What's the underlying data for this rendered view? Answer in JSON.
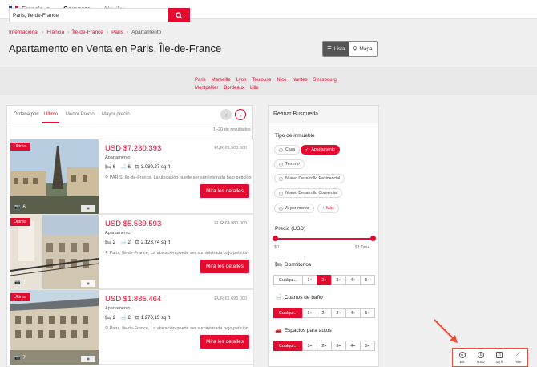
{
  "colors": {
    "brand": "#e30b2f",
    "flag": [
      "#1a3c8f",
      "#ffffff",
      "#e30b2f"
    ]
  },
  "header": {
    "country": "Francia",
    "tabs": [
      {
        "label": "Comprar",
        "active": true
      },
      {
        "label": "Alquilar",
        "active": false
      }
    ]
  },
  "breadcrumb": [
    "Internacional",
    "Francia",
    "Île-de-France",
    "Paris",
    "Apartamento"
  ],
  "page_title": "Apartamento en Venta en Paris, Île-de-France",
  "view_toggle": {
    "list_label": "Lista",
    "map_label": "Mapa",
    "selected": "list"
  },
  "search": {
    "value": "Paris, Île-de-France",
    "button_icon": "search-icon",
    "cities": [
      "Paris",
      "Marseille",
      "Lyon",
      "Toulouse",
      "Nice",
      "Nantes",
      "Strasbourg",
      "Montpellier",
      "Bordeaux",
      "Lille"
    ]
  },
  "sort": {
    "label": "Ordena por:",
    "options": [
      "Último",
      "Menor Precio",
      "Mayor precio"
    ],
    "selected": 0
  },
  "results_count": "1–20 de resultados",
  "listings": [
    {
      "badge": "Último",
      "photo_count": "6",
      "price": "USD $7.230.393",
      "eur_price": "EUR €6.500.000",
      "type": "Apartamento",
      "bedrooms": "6",
      "bathrooms": "6",
      "area": "3.089,27 sq ft",
      "location": "PARIS, Île-de-France, La ubicación puede ser suministrada bajo petición",
      "button": "Mira los detalles"
    },
    {
      "badge": "Último",
      "photo_count": "7",
      "price": "USD $5.539.593",
      "eur_price": "EUR €4.980.000",
      "type": "Apartamento",
      "bedrooms": "2",
      "bathrooms": "2",
      "area": "2.123,74 sq ft",
      "location": "Paris, Île-de-France, La ubicación puede ser suministrada bajo petición",
      "button": "Mira los detalles"
    },
    {
      "badge": "Último",
      "photo_count": "7",
      "price": "USD $1.885.464",
      "eur_price": "EUR €1.695.000",
      "type": "Apartamento",
      "bedrooms": "2",
      "bathrooms": "2",
      "area": "1.270,15 sq ft",
      "location": "Paris, Île-de-France, La ubicación puede ser suministrada bajo petición",
      "button": "Mira los detalles"
    }
  ],
  "filters": {
    "title": "Refinar Busqueda",
    "property_type": {
      "label": "Tipo de inmueble",
      "options": [
        "Casa",
        "Apartamento",
        "Terreno",
        "Nuevo Desarrollo Residencial",
        "Nuevo Desarrollo Comercial",
        "Al por menor"
      ],
      "selected": "Apartamento",
      "more_label": "Más"
    },
    "price": {
      "label": "Precio (USD)",
      "min_label": "$0",
      "max_label": "$1,0m+",
      "min_fraction": 0,
      "max_fraction": 1
    },
    "bedrooms": {
      "label": "Dormitorios",
      "options": [
        "Cualqui...",
        "1+",
        "2+",
        "3+",
        "4+",
        "5+"
      ],
      "selected": "2+"
    },
    "bathrooms": {
      "label": "Cuartos de baño",
      "options": [
        "Cualqui...",
        "1+",
        "2+",
        "3+",
        "4+",
        "5+"
      ],
      "selected": "Cualqui..."
    },
    "parking": {
      "label": "Espacios para autos",
      "options": [
        "Cualqui...",
        "1+",
        "2+",
        "3+",
        "4+",
        "5+"
      ],
      "selected": "Cualqui..."
    }
  },
  "preferences": [
    {
      "icon": "globe-icon",
      "label": "ES"
    },
    {
      "icon": "dollar-icon",
      "label": "USD"
    },
    {
      "icon": "area-icon",
      "label": "sq ft"
    },
    {
      "icon": "ruler-icon",
      "label": "mile"
    }
  ]
}
